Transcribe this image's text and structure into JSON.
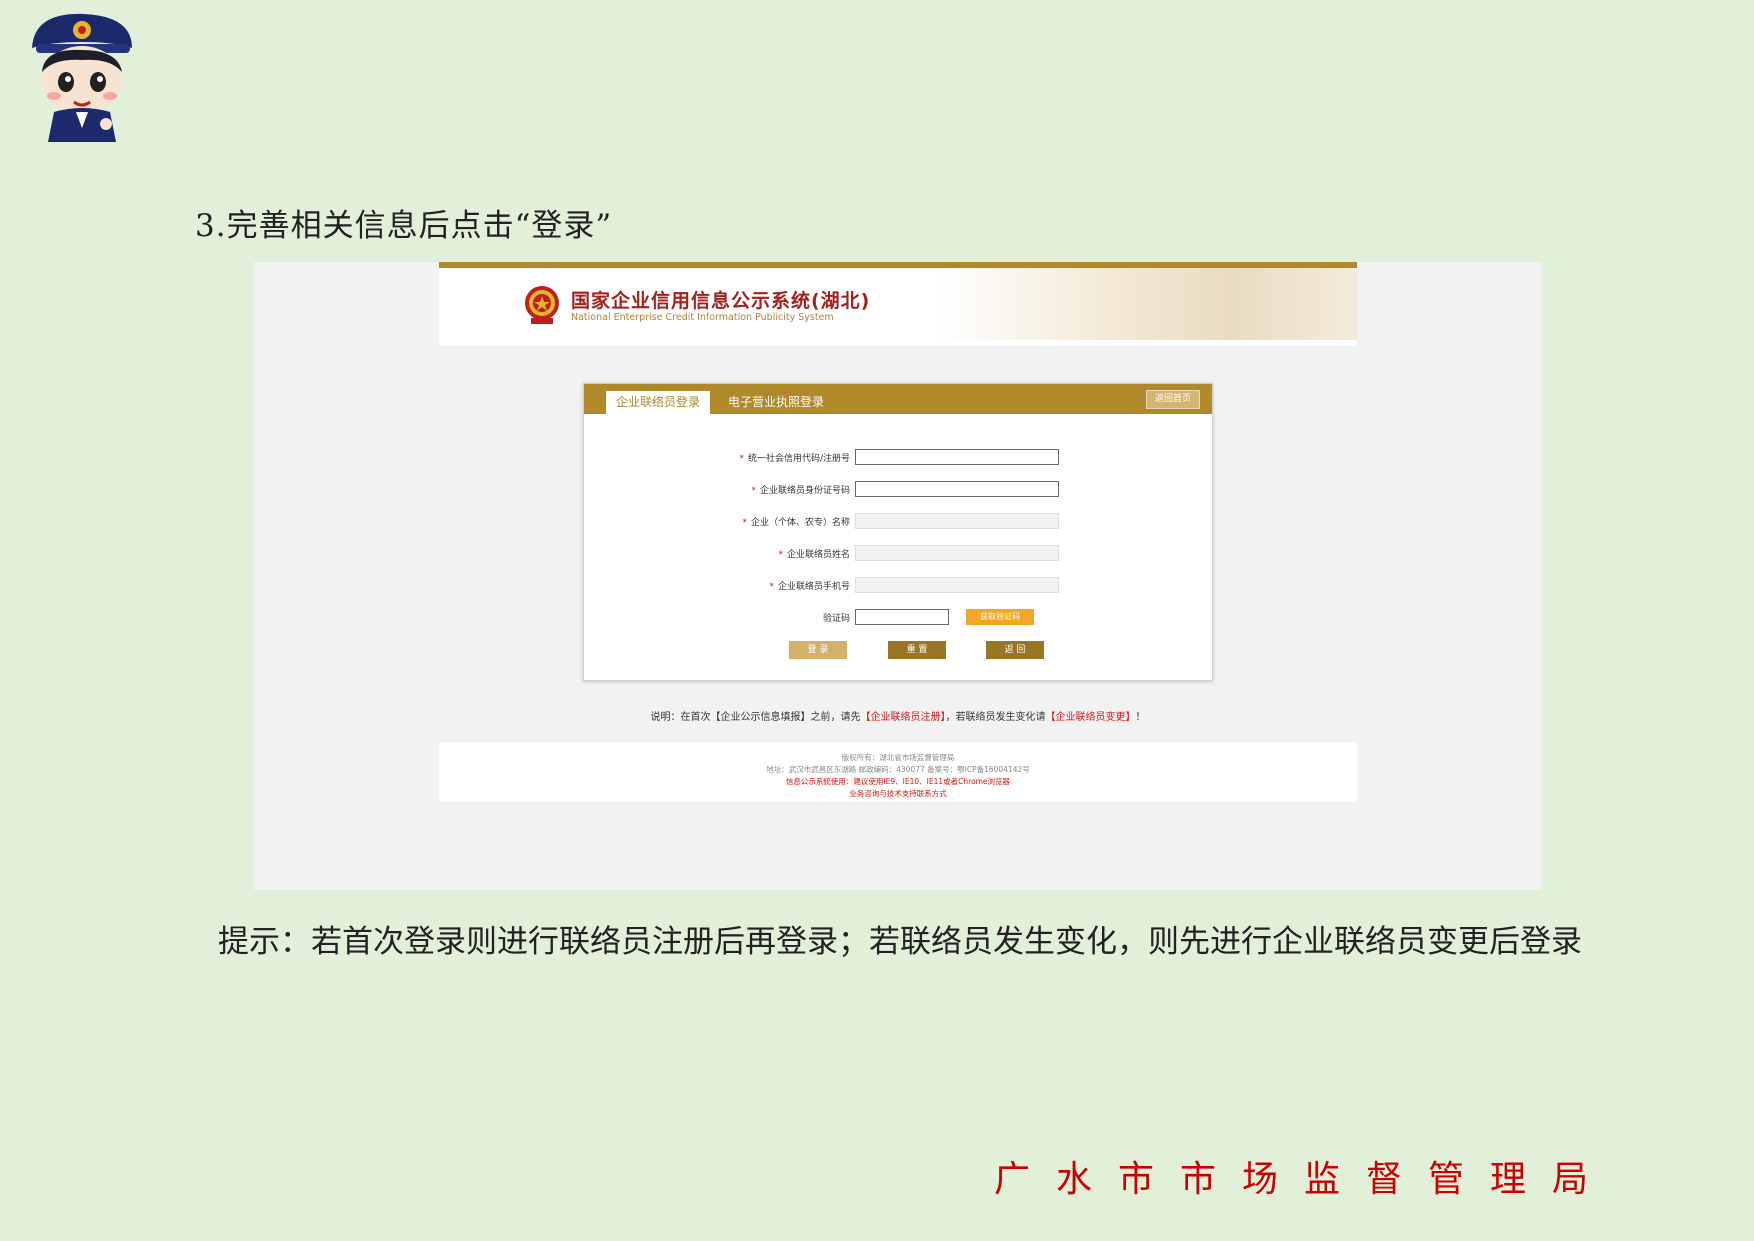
{
  "step_heading": "3.完善相关信息后点击“登录”",
  "banner": {
    "title": "国家企业信用信息公示系统(湖北)",
    "subtitle": "National Enterprise Credit Information Publicity System"
  },
  "login_card": {
    "tabs": [
      {
        "label": "企业联络员登录",
        "active": true
      },
      {
        "label": "电子营业执照登录",
        "active": false
      }
    ],
    "back_home_label": "返回首页",
    "fields": [
      {
        "label": "统一社会信用代码/注册号",
        "required": true,
        "disabled": false,
        "value": ""
      },
      {
        "label": "企业联络员身份证号码",
        "required": true,
        "disabled": false,
        "value": ""
      },
      {
        "label": "企业（个体、农专）名称",
        "required": true,
        "disabled": true,
        "value": ""
      },
      {
        "label": "企业联络员姓名",
        "required": true,
        "disabled": true,
        "value": ""
      },
      {
        "label": "企业联络员手机号",
        "required": true,
        "disabled": true,
        "value": ""
      }
    ],
    "captcha": {
      "label": "验证码",
      "value": "",
      "button_label": "获取验证码"
    },
    "required_mark": "*",
    "buttons": {
      "login": "登 录",
      "reset": "重 置",
      "back": "返 回"
    }
  },
  "note": {
    "prefix": "说明：在首次【企业公示信息填报】之前，请先",
    "link1": "【企业联络员注册】",
    "middle": "，若联络员发生变化请",
    "link2": "【企业联络员变更】",
    "suffix": "！"
  },
  "footer": {
    "line1": "版权所有：湖北省市场监督管理局",
    "line2": "地址：武汉市武昌区东湖路 邮政编码：430077 备案号：鄂ICP备16004142号",
    "line3": "信息公示系统使用：建议使用IE9、IE10、IE11或者Chrome浏览器",
    "line4": "业务咨询与技术支持联系方式"
  },
  "tip": "提示：若首次登录则进行联络员注册后再登录；若联络员发生变化，则先进行企业联络员变更后登录",
  "organization": "广水市市场监督管理局",
  "colors": {
    "page_bg": "#e2efd9",
    "gold": "#b0892b",
    "red": "#c00",
    "captcha_btn": "#f5a623"
  }
}
